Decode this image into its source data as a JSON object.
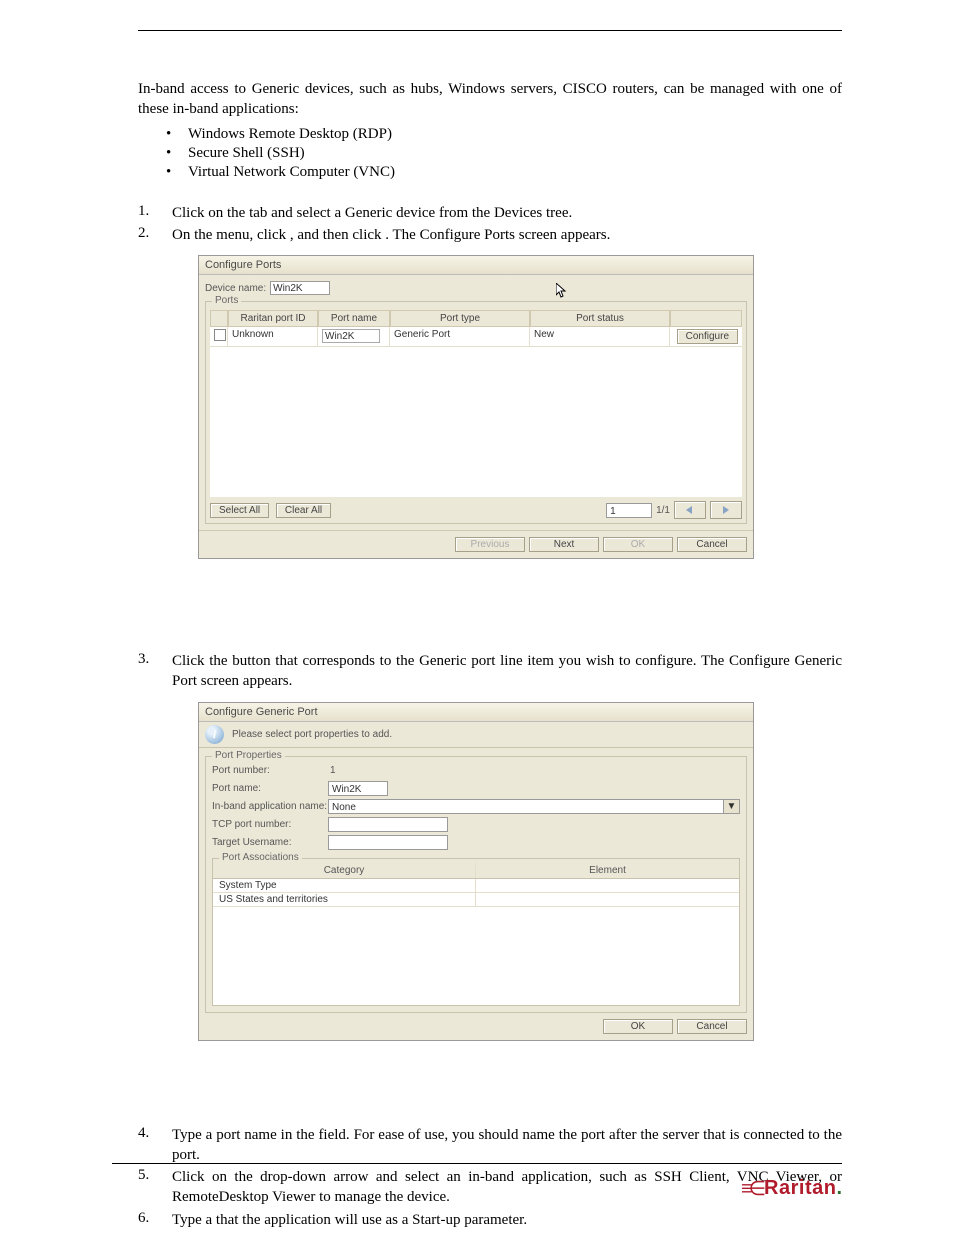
{
  "paragraphs": {
    "intro": "In-band access to Generic devices, such as hubs, Windows servers, CISCO routers, can be managed with one of these in-band applications:"
  },
  "apps": [
    "Windows Remote Desktop (RDP)",
    "Secure Shell (SSH)",
    "Virtual Network Computer (VNC)"
  ],
  "steps_a": [
    {
      "n": "1.",
      "t": "Click on the            tab and select a Generic device from the Devices tree."
    },
    {
      "n": "2.",
      "t": "On the             menu, click                          , and then click                        . The Configure Ports screen appears."
    }
  ],
  "steps_b": [
    {
      "n": "3.",
      "t": "Click  the                    button  that  corresponds  to  the  Generic  port  line  item  you  wish  to configure. The Configure Generic Port screen appears."
    }
  ],
  "steps_c": [
    {
      "n": "4.",
      "t": "Type a port name in the                   field. For ease of use, you should name the port after the server that is connected to the port."
    },
    {
      "n": "5.",
      "t": "Click on the                                           drop-down arrow and select an in-band application, such as SSH Client, VNC Viewer, or RemoteDesktop Viewer to manage the device."
    },
    {
      "n": "6.",
      "t": "Type a                                  that the application will use as a Start-up parameter."
    }
  ],
  "screen1": {
    "title": "Configure Ports",
    "device_name_label": "Device name:",
    "device_name_value": "Win2K",
    "ports_legend": "Ports",
    "headers": {
      "raritan_port_id": "Raritan port ID",
      "port_name": "Port name",
      "port_type": "Port type",
      "port_status": "Port status"
    },
    "row": {
      "id": "Unknown",
      "name": "Win2K",
      "type": "Generic Port",
      "status": "New"
    },
    "buttons": {
      "configure": "Configure",
      "select_all": "Select All",
      "clear_all": "Clear All",
      "previous": "Previous",
      "next": "Next",
      "ok": "OK",
      "cancel": "Cancel"
    },
    "page_value": "1",
    "page_count": "1/1",
    "caption": ""
  },
  "screen2": {
    "title": "Configure Generic Port",
    "info": "Please select port properties to add.",
    "port_props_legend": "Port Properties",
    "fields": {
      "port_number_label": "Port number:",
      "port_number_value": "1",
      "port_name_label": "Port name:",
      "port_name_value": "Win2K",
      "inband_label": "In-band application name:",
      "inband_value": "None",
      "tcp_label": "TCP port number:",
      "tcp_value": "",
      "target_user_label": "Target Username:",
      "target_user_value": ""
    },
    "assoc_legend": "Port Associations",
    "assoc_headers": {
      "category": "Category",
      "element": "Element"
    },
    "assoc_rows": [
      {
        "cat": "System Type",
        "elem": ""
      },
      {
        "cat": "US States and territories",
        "elem": ""
      }
    ],
    "buttons": {
      "ok": "OK",
      "cancel": "Cancel"
    },
    "caption": ""
  },
  "brand": "Raritan"
}
